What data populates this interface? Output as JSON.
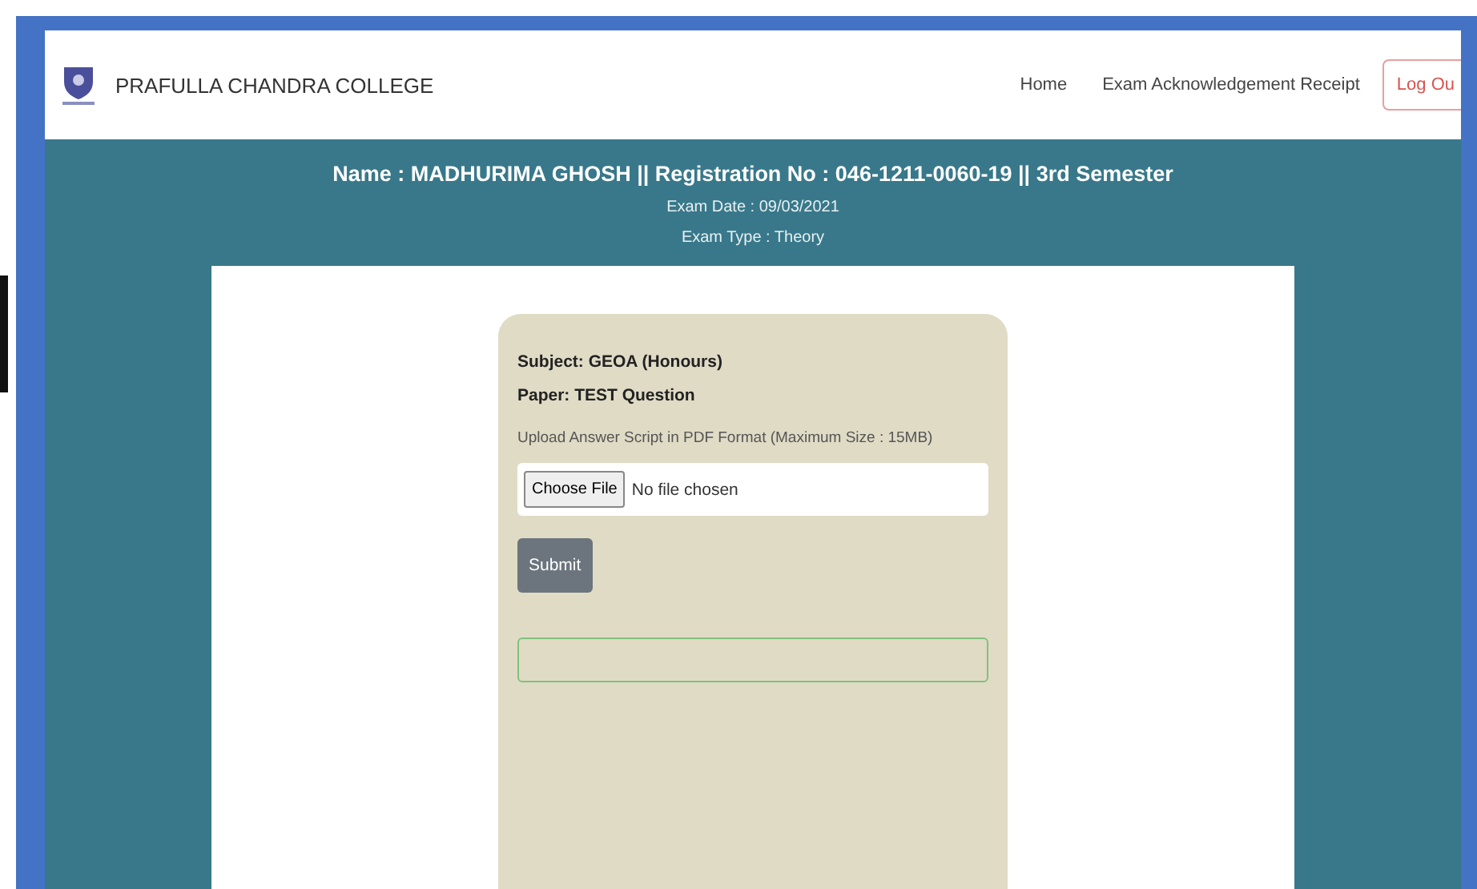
{
  "header": {
    "college_name": "PRAFULLA CHANDRA COLLEGE",
    "nav_links": [
      {
        "label": "Home"
      },
      {
        "label": "Exam Acknowledgement Receipt"
      }
    ],
    "logout_button": "Log Ou"
  },
  "student_info": {
    "title": "Name : MADHURIMA GHOSH || Registration No : 046-1211-0060-19 || 3rd Semester",
    "exam_date": "Exam Date : 09/03/2021",
    "exam_type": "Exam Type : Theory"
  },
  "upload_card": {
    "subject": "Subject: GEOA (Honours)",
    "paper": "Paper: TEST Question",
    "instruction": "Upload Answer Script in PDF Format (Maximum Size : 15MB)",
    "file_button": "Choose File",
    "file_status": "No file chosen",
    "submit_button": "Submit"
  }
}
